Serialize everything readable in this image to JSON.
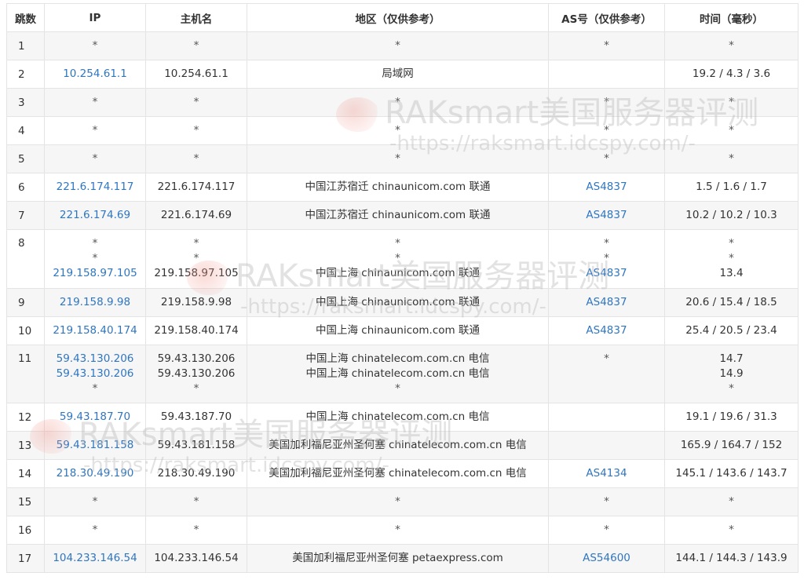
{
  "headers": {
    "hop": "跳数",
    "ip": "IP",
    "host": "主机名",
    "region": "地区（仅供参考）",
    "asn": "AS号（仅供参考）",
    "time": "时间（毫秒）"
  },
  "rows": [
    {
      "hop": "1",
      "ip": [
        "*"
      ],
      "host": [
        "*"
      ],
      "region": [
        "*"
      ],
      "asn": [
        "*"
      ],
      "time": [
        "*"
      ]
    },
    {
      "hop": "2",
      "ip": [
        "10.254.61.1"
      ],
      "host": [
        "10.254.61.1"
      ],
      "region": [
        "局域网"
      ],
      "asn": [
        ""
      ],
      "time": [
        "19.2 / 4.3 / 3.6"
      ]
    },
    {
      "hop": "3",
      "ip": [
        "*"
      ],
      "host": [
        "*"
      ],
      "region": [
        "*"
      ],
      "asn": [
        "*"
      ],
      "time": [
        "*"
      ]
    },
    {
      "hop": "4",
      "ip": [
        "*"
      ],
      "host": [
        "*"
      ],
      "region": [
        "*"
      ],
      "asn": [
        "*"
      ],
      "time": [
        "*"
      ]
    },
    {
      "hop": "5",
      "ip": [
        "*"
      ],
      "host": [
        "*"
      ],
      "region": [
        "*"
      ],
      "asn": [
        "*"
      ],
      "time": [
        "*"
      ]
    },
    {
      "hop": "6",
      "ip": [
        "221.6.174.117"
      ],
      "host": [
        "221.6.174.117"
      ],
      "region": [
        "中国江苏宿迁 chinaunicom.com 联通"
      ],
      "asn": [
        "AS4837"
      ],
      "time": [
        "1.5 / 1.6 / 1.7"
      ]
    },
    {
      "hop": "7",
      "ip": [
        "221.6.174.69"
      ],
      "host": [
        "221.6.174.69"
      ],
      "region": [
        "中国江苏宿迁 chinaunicom.com 联通"
      ],
      "asn": [
        "AS4837"
      ],
      "time": [
        "10.2 / 10.2 / 10.3"
      ]
    },
    {
      "hop": "8",
      "ip": [
        "*",
        "*",
        "219.158.97.105"
      ],
      "host": [
        "*",
        "*",
        "219.158.97.105"
      ],
      "region": [
        "*",
        "*",
        "中国上海 chinaunicom.com 联通"
      ],
      "asn": [
        "*",
        "*",
        "AS4837"
      ],
      "time": [
        "*",
        "*",
        "13.4"
      ]
    },
    {
      "hop": "9",
      "ip": [
        "219.158.9.98"
      ],
      "host": [
        "219.158.9.98"
      ],
      "region": [
        "中国上海 chinaunicom.com 联通"
      ],
      "asn": [
        "AS4837"
      ],
      "time": [
        "20.6 / 15.4 / 18.5"
      ]
    },
    {
      "hop": "10",
      "ip": [
        "219.158.40.174"
      ],
      "host": [
        "219.158.40.174"
      ],
      "region": [
        "中国上海 chinaunicom.com 联通"
      ],
      "asn": [
        "AS4837"
      ],
      "time": [
        "25.4 / 20.5 / 23.4"
      ]
    },
    {
      "hop": "11",
      "ip": [
        "59.43.130.206",
        "59.43.130.206",
        "*"
      ],
      "host": [
        "59.43.130.206",
        "59.43.130.206",
        "*"
      ],
      "region": [
        "中国上海 chinatelecom.com.cn 电信",
        "中国上海 chinatelecom.com.cn 电信",
        "*"
      ],
      "asn": [
        "",
        "",
        "*"
      ],
      "time": [
        "14.7",
        "14.9",
        "*"
      ]
    },
    {
      "hop": "12",
      "ip": [
        "59.43.187.70"
      ],
      "host": [
        "59.43.187.70"
      ],
      "region": [
        "中国上海 chinatelecom.com.cn 电信"
      ],
      "asn": [
        ""
      ],
      "time": [
        "19.1 / 19.6 / 31.3"
      ]
    },
    {
      "hop": "13",
      "ip": [
        "59.43.181.158"
      ],
      "host": [
        "59.43.181.158"
      ],
      "region": [
        "美国加利福尼亚州圣何塞 chinatelecom.com.cn 电信"
      ],
      "asn": [
        ""
      ],
      "time": [
        "165.9 / 164.7 / 152"
      ]
    },
    {
      "hop": "14",
      "ip": [
        "218.30.49.190"
      ],
      "host": [
        "218.30.49.190"
      ],
      "region": [
        "美国加利福尼亚州圣何塞 chinatelecom.com.cn 电信"
      ],
      "asn": [
        "AS4134"
      ],
      "time": [
        "145.1 / 143.6 / 143.7"
      ]
    },
    {
      "hop": "15",
      "ip": [
        "*"
      ],
      "host": [
        "*"
      ],
      "region": [
        "*"
      ],
      "asn": [
        "*"
      ],
      "time": [
        "*"
      ]
    },
    {
      "hop": "16",
      "ip": [
        "*"
      ],
      "host": [
        "*"
      ],
      "region": [
        "*"
      ],
      "asn": [
        "*"
      ],
      "time": [
        "*"
      ]
    },
    {
      "hop": "17",
      "ip": [
        "104.233.146.54"
      ],
      "host": [
        "104.233.146.54"
      ],
      "region": [
        "美国加利福尼亚州圣何塞 petaexpress.com"
      ],
      "asn": [
        "AS54600"
      ],
      "time": [
        "144.1 / 144.3 / 143.9"
      ]
    }
  ],
  "watermark": {
    "title": "RAKsmart美国服务器评测",
    "url": "-https://raksmart.idcspy.com/-"
  },
  "colors": {
    "link": "#2f76c1",
    "stripe": "#f6f6f6",
    "border": "#e4e4e4"
  }
}
